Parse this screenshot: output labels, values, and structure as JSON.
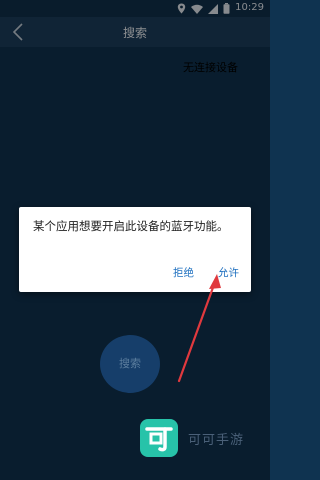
{
  "status_bar": {
    "time": "10:29",
    "icons": [
      "location-icon",
      "wifi-icon",
      "cellular-signal-icon",
      "battery-icon"
    ]
  },
  "app_bar": {
    "title": "搜索",
    "back_icon": "chevron-left-icon"
  },
  "main": {
    "no_device_text": "无连接设备",
    "search_button_label": "搜索"
  },
  "dialog": {
    "message": "某个应用想要开启此设备的蓝牙功能。",
    "deny_label": "拒绝",
    "allow_label": "允许"
  },
  "watermark": {
    "logo_glyph": "可",
    "text": "可可手游"
  },
  "annotation": {
    "arrow_color": "#e0393e"
  },
  "colors": {
    "background": "#103350",
    "app_bar": "#1c3e5d",
    "accent": "#1e6fbf",
    "watermark_logo": "#27c3a9"
  }
}
